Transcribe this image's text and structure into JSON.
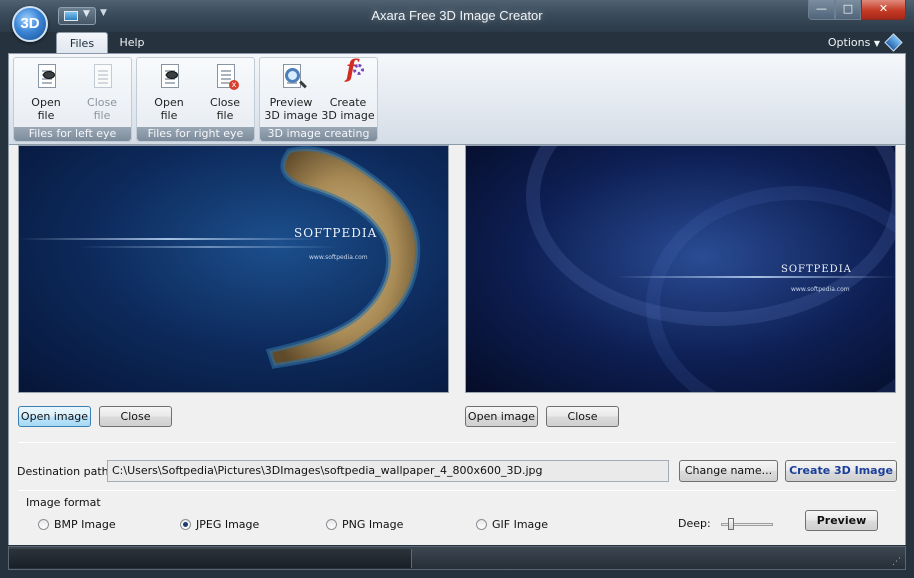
{
  "window": {
    "title": "Axara Free 3D Image Creator",
    "orb_label": "3D"
  },
  "titlebar_buttons": {
    "minimize": "—",
    "maximize": "□",
    "close": "✕"
  },
  "ribbon": {
    "tabs": [
      {
        "label": "Files",
        "active": true
      },
      {
        "label": "Help",
        "active": false
      }
    ],
    "options_label": "Options",
    "groups": [
      {
        "label": "Files for left eye",
        "buttons": [
          {
            "label": "Open file"
          },
          {
            "label": "Close file"
          }
        ]
      },
      {
        "label": "Files for right eye",
        "buttons": [
          {
            "label": "Open file"
          },
          {
            "label": "Close file"
          }
        ]
      },
      {
        "label": "3D image creating",
        "buttons": [
          {
            "label": "Preview 3D image"
          },
          {
            "label": "Create 3D image"
          }
        ]
      }
    ]
  },
  "left_panel": {
    "open_button": "Open image",
    "close_button": "Close",
    "image": {
      "watermark": "SOFTPEDIA",
      "url": "www.softpedia.com"
    }
  },
  "right_panel": {
    "open_button": "Open image",
    "close_button": "Close",
    "image": {
      "watermark": "SOFTPEDIA",
      "url": "www.softpedia.com"
    }
  },
  "destination": {
    "label": "Destination path:",
    "value": "C:\\Users\\Softpedia\\Pictures\\3DImages\\softpedia_wallpaper_4_800x600_3D.jpg",
    "change_button": "Change name...",
    "create_button": "Create 3D Image"
  },
  "image_format": {
    "label": "Image format",
    "options": [
      {
        "label": "BMP Image",
        "checked": false
      },
      {
        "label": "JPEG Image",
        "checked": true
      },
      {
        "label": "PNG Image",
        "checked": false
      },
      {
        "label": "GIF Image",
        "checked": false
      }
    ],
    "deep_label": "Deep:",
    "deep_value": 0.15,
    "preview_button": "Preview"
  },
  "colors": {
    "accent": "#1b3f9a",
    "titlebar": "#3a4b5b",
    "close": "#c43b25"
  }
}
